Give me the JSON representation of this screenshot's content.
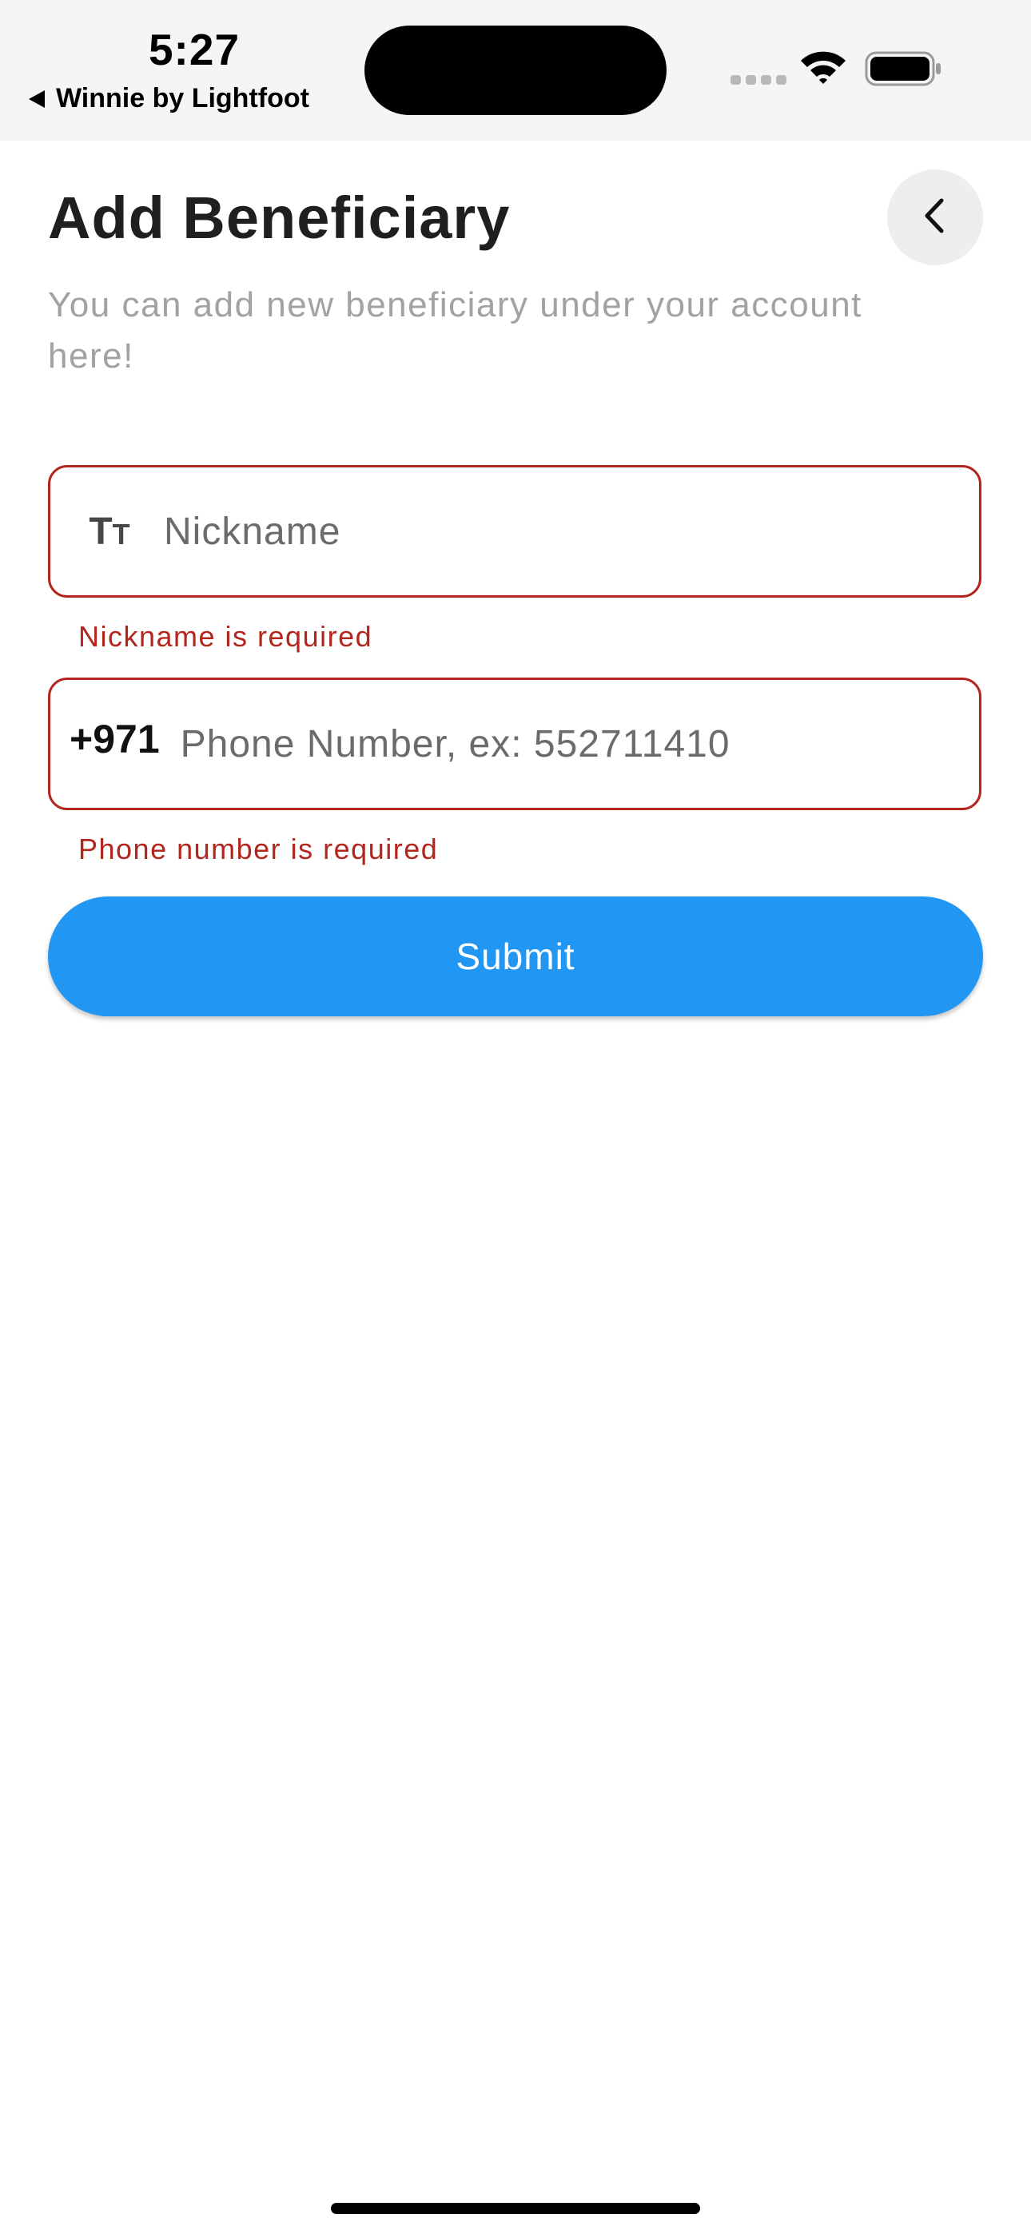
{
  "status_bar": {
    "time": "5:27",
    "back_app_label": "Winnie by Lightfoot",
    "icons": [
      "cellular-signal-icon",
      "wifi-icon",
      "battery-icon"
    ]
  },
  "header": {
    "title": "Add Beneficiary",
    "subtitle": "You can add new beneficiary under your account here!",
    "back_icon": "chevron-left-icon"
  },
  "form": {
    "nickname": {
      "icon": "text-format-icon",
      "icon_text": "T",
      "icon_text_small": "T",
      "value": "",
      "placeholder": "Nickname",
      "error": "Nickname is required"
    },
    "phone": {
      "country_code": "+971",
      "value": "",
      "placeholder": "Phone Number, ex: 552711410",
      "error": "Phone number is required"
    },
    "submit_label": "Submit"
  },
  "colors": {
    "accent": "#2196F3",
    "error": "#B3261E",
    "title": "#1F1F1F",
    "subtitle": "#A2A2A2",
    "status_bar_bg": "#F5F5F5"
  }
}
